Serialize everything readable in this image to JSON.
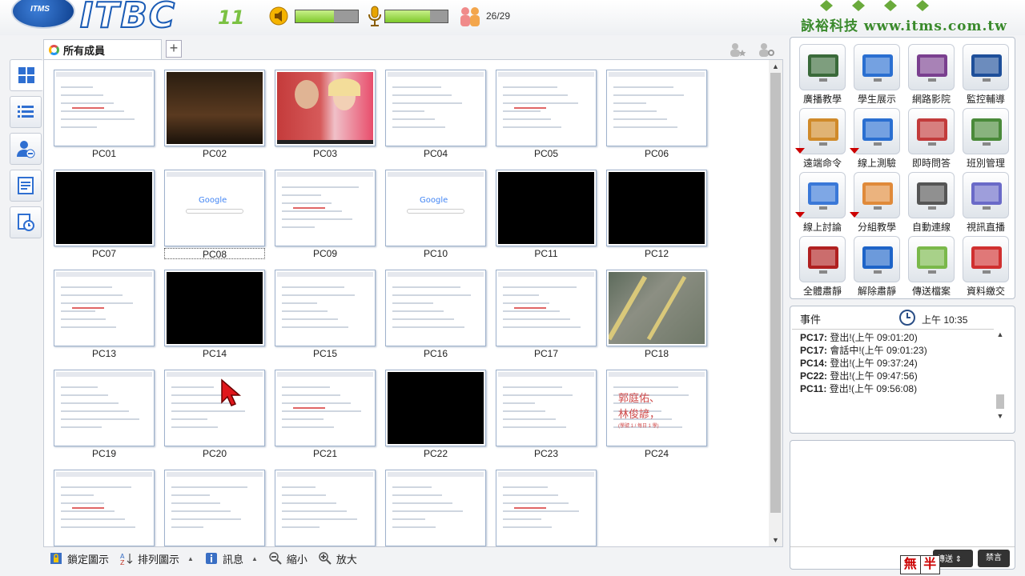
{
  "header": {
    "logo_badge": "ITMS",
    "logo_text": "ITBC",
    "logo_version": "11",
    "speaker_level": 0.62,
    "mic_level": 0.72,
    "user_count": "26/29",
    "company": "詠裕科技 www.itms.com.tw",
    "accent": "#1a5bb5"
  },
  "tabs": {
    "all_members": "所有成員",
    "add": "+"
  },
  "pcs": [
    {
      "label": "PC01",
      "screen": "white"
    },
    {
      "label": "PC02",
      "screen": "black"
    },
    {
      "label": "PC03",
      "screen": "video"
    },
    {
      "label": "PC04",
      "screen": "white"
    },
    {
      "label": "PC05",
      "screen": "white"
    },
    {
      "label": "PC06",
      "screen": "white"
    },
    {
      "label": "PC07",
      "screen": "black"
    },
    {
      "label": "PC08",
      "screen": "google"
    },
    {
      "label": "PC09",
      "screen": "white"
    },
    {
      "label": "PC10",
      "screen": "google"
    },
    {
      "label": "PC11",
      "screen": "black"
    },
    {
      "label": "PC12",
      "screen": "black"
    },
    {
      "label": "PC13",
      "screen": "white"
    },
    {
      "label": "PC14",
      "screen": "black"
    },
    {
      "label": "PC15",
      "screen": "white"
    },
    {
      "label": "PC16",
      "screen": "white"
    },
    {
      "label": "PC17",
      "screen": "white"
    },
    {
      "label": "PC18",
      "screen": "map"
    },
    {
      "label": "PC19",
      "screen": "white"
    },
    {
      "label": "PC20",
      "screen": "white"
    },
    {
      "label": "PC21",
      "screen": "white"
    },
    {
      "label": "PC22",
      "screen": "black"
    },
    {
      "label": "PC23",
      "screen": "white"
    },
    {
      "label": "PC24",
      "screen": "names"
    },
    {
      "label": "",
      "screen": "white"
    },
    {
      "label": "",
      "screen": "white"
    },
    {
      "label": "",
      "screen": "white"
    },
    {
      "label": "",
      "screen": "white"
    },
    {
      "label": "",
      "screen": "white"
    }
  ],
  "pc24_text": {
    "line1": "郭庭佑、",
    "line2": "林俊諺，",
    "note": "(學號 1 / 每日 1 學)"
  },
  "google_word": "Google",
  "bottom_bar": {
    "lock": "鎖定圖示",
    "arrange": "排列圖示",
    "info": "訊息",
    "zoom_out": "縮小",
    "zoom_in": "放大"
  },
  "functions": [
    {
      "label": "廣播教學",
      "icon": "broadcast-icon",
      "menu": false
    },
    {
      "label": "學生展示",
      "icon": "student-demo-icon",
      "menu": false
    },
    {
      "label": "網路影院",
      "icon": "web-cinema-icon",
      "menu": false
    },
    {
      "label": "監控輔導",
      "icon": "monitor-icon",
      "menu": false
    },
    {
      "label": "遠端命令",
      "icon": "remote-command-icon",
      "menu": true
    },
    {
      "label": "線上測驗",
      "icon": "online-test-icon",
      "menu": true
    },
    {
      "label": "即時問答",
      "icon": "quiz-icon",
      "menu": false
    },
    {
      "label": "班別管理",
      "icon": "class-manage-icon",
      "menu": false
    },
    {
      "label": "線上討論",
      "icon": "discussion-icon",
      "menu": true
    },
    {
      "label": "分組教學",
      "icon": "group-teaching-icon",
      "menu": true
    },
    {
      "label": "自動連線",
      "icon": "auto-connect-icon",
      "menu": false
    },
    {
      "label": "視訊直播",
      "icon": "live-video-icon",
      "menu": false
    },
    {
      "label": "全體肅靜",
      "icon": "silence-all-icon",
      "menu": false
    },
    {
      "label": "解除肅靜",
      "icon": "unsilence-icon",
      "menu": false
    },
    {
      "label": "傳送檔案",
      "icon": "send-file-icon",
      "menu": false
    },
    {
      "label": "資料繳交",
      "icon": "submit-data-icon",
      "menu": false
    }
  ],
  "events": {
    "title": "事件",
    "time": "上午 10:35",
    "items": [
      {
        "pc": "PC17:",
        "text": "登出!(上午 09:01:20)"
      },
      {
        "pc": "PC17:",
        "text": "會話中!(上午 09:01:23)"
      },
      {
        "pc": "PC14:",
        "text": "登出!(上午 09:37:24)"
      },
      {
        "pc": "PC22:",
        "text": "登出!(上午 09:47:56)"
      },
      {
        "pc": "PC11:",
        "text": "登出!(上午 09:56:08)"
      }
    ]
  },
  "chat": {
    "send_label": "傳送",
    "forbid_label": "禁言"
  },
  "ime": {
    "mode": "無",
    "width": "半"
  }
}
